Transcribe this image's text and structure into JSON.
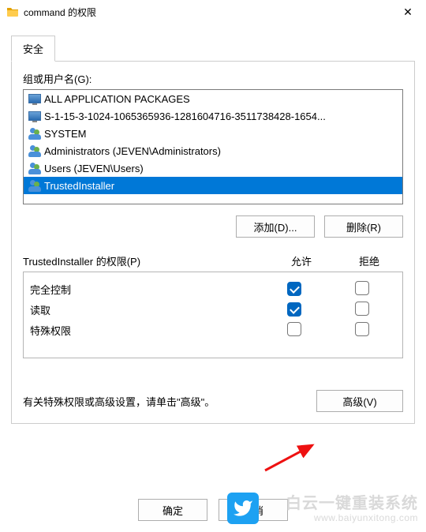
{
  "window": {
    "title": "command 的权限",
    "close_glyph": "✕"
  },
  "tab": {
    "label": "安全"
  },
  "groups": {
    "label": "组或用户名(G):",
    "items": [
      {
        "icon": "monitor",
        "text": "ALL APPLICATION PACKAGES",
        "selected": false
      },
      {
        "icon": "monitor",
        "text": "S-1-15-3-1024-1065365936-1281604716-3511738428-1654...",
        "selected": false
      },
      {
        "icon": "people",
        "text": "SYSTEM",
        "selected": false
      },
      {
        "icon": "people",
        "text": "Administrators (JEVEN\\Administrators)",
        "selected": false
      },
      {
        "icon": "people",
        "text": "Users (JEVEN\\Users)",
        "selected": false
      },
      {
        "icon": "people",
        "text": "TrustedInstaller",
        "selected": true
      }
    ]
  },
  "buttons": {
    "add": "添加(D)...",
    "remove": "删除(R)",
    "advanced": "高级(V)",
    "ok": "确定",
    "cancel": "取消"
  },
  "permissions": {
    "header": "TrustedInstaller 的权限(P)",
    "col_allow": "允许",
    "col_deny": "拒绝",
    "rows": [
      {
        "label": "完全控制",
        "allow": true,
        "deny": false
      },
      {
        "label": "读取",
        "allow": true,
        "deny": false
      },
      {
        "label": "特殊权限",
        "allow": false,
        "deny": false
      }
    ]
  },
  "advanced_hint": "有关特殊权限或高级设置，请单击\"高级\"。",
  "watermark": {
    "line1": "白云一键重装系统",
    "line2": "www.baiyunxitong.com"
  }
}
